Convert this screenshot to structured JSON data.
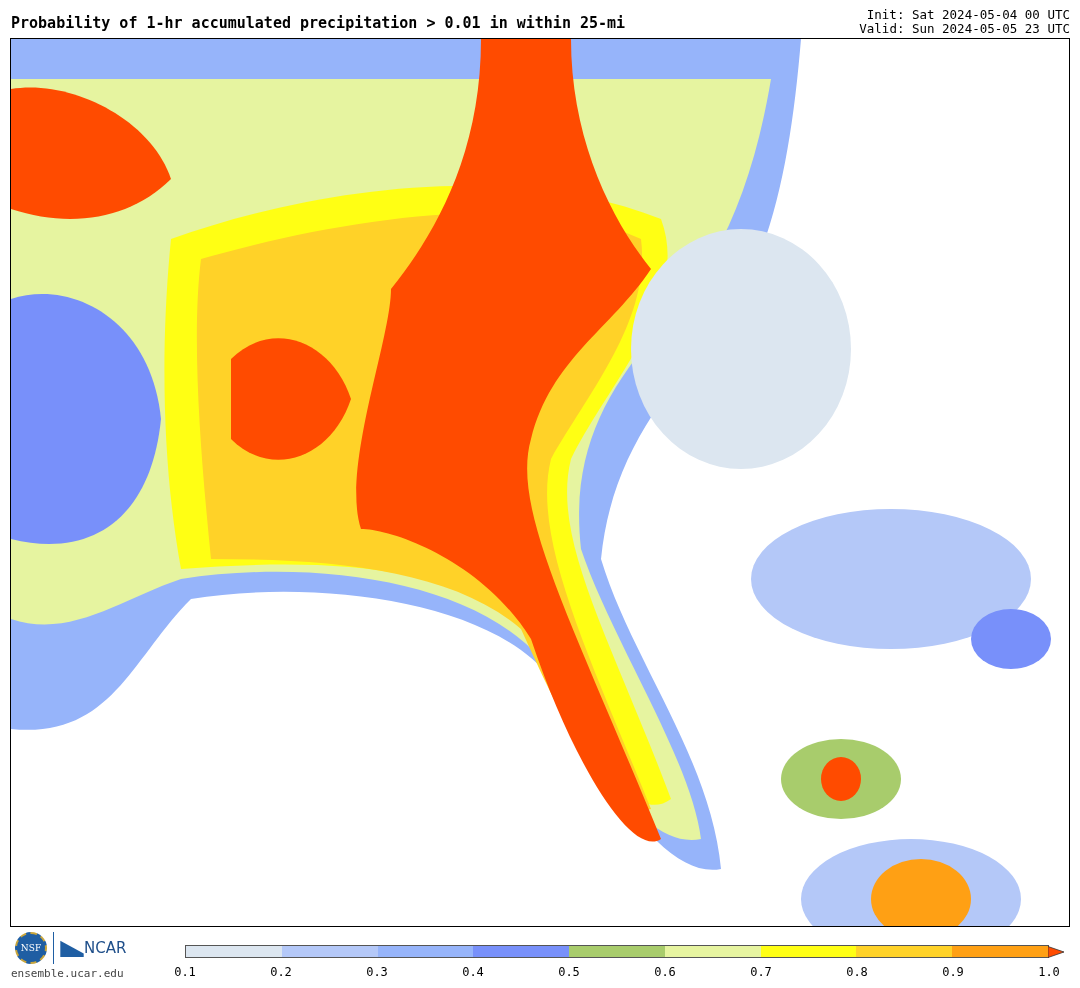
{
  "header": {
    "title": "Probability of 1-hr accumulated precipitation > 0.01 in within 25-mi",
    "init": "Init: Sat 2024-05-04 00 UTC",
    "valid": "Valid: Sun 2024-05-05 23 UTC"
  },
  "logos": {
    "nsf": "NSF",
    "ncar": "NCAR",
    "site": "ensemble.ucar.edu"
  },
  "colorbar": {
    "bins": [
      {
        "color": "#dce6f0"
      },
      {
        "color": "#b4c8f8"
      },
      {
        "color": "#96b4fa"
      },
      {
        "color": "#7890fa"
      },
      {
        "color": "#a8cc6c"
      },
      {
        "color": "#e6f4a0"
      },
      {
        "color": "#ffff14"
      },
      {
        "color": "#ffd228"
      },
      {
        "color": "#ffa014"
      }
    ],
    "extension": {
      "color": "#ff4b00"
    },
    "ticks": [
      "0.1",
      "0.2",
      "0.3",
      "0.4",
      "0.5",
      "0.6",
      "0.7",
      "0.8",
      "0.9",
      "1.0"
    ]
  }
}
